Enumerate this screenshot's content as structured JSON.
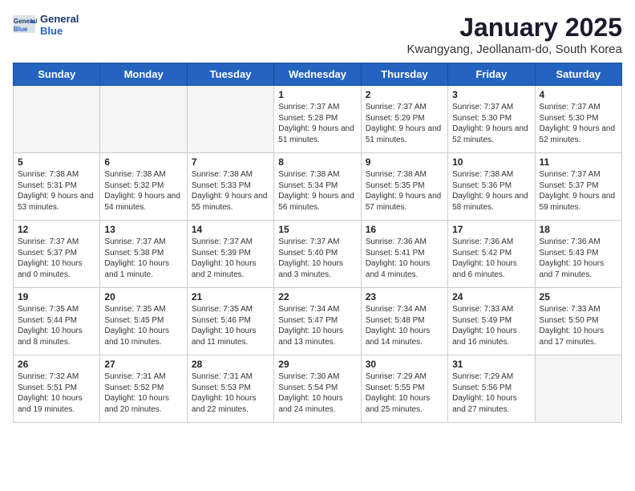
{
  "header": {
    "logo_line1": "General",
    "logo_line2": "Blue",
    "title": "January 2025",
    "subtitle": "Kwangyang, Jeollanam-do, South Korea"
  },
  "days_of_week": [
    "Sunday",
    "Monday",
    "Tuesday",
    "Wednesday",
    "Thursday",
    "Friday",
    "Saturday"
  ],
  "weeks": [
    [
      {
        "day": "",
        "text": ""
      },
      {
        "day": "",
        "text": ""
      },
      {
        "day": "",
        "text": ""
      },
      {
        "day": "1",
        "text": "Sunrise: 7:37 AM\nSunset: 5:28 PM\nDaylight: 9 hours and 51 minutes."
      },
      {
        "day": "2",
        "text": "Sunrise: 7:37 AM\nSunset: 5:29 PM\nDaylight: 9 hours and 51 minutes."
      },
      {
        "day": "3",
        "text": "Sunrise: 7:37 AM\nSunset: 5:30 PM\nDaylight: 9 hours and 52 minutes."
      },
      {
        "day": "4",
        "text": "Sunrise: 7:37 AM\nSunset: 5:30 PM\nDaylight: 9 hours and 52 minutes."
      }
    ],
    [
      {
        "day": "5",
        "text": "Sunrise: 7:38 AM\nSunset: 5:31 PM\nDaylight: 9 hours and 53 minutes."
      },
      {
        "day": "6",
        "text": "Sunrise: 7:38 AM\nSunset: 5:32 PM\nDaylight: 9 hours and 54 minutes."
      },
      {
        "day": "7",
        "text": "Sunrise: 7:38 AM\nSunset: 5:33 PM\nDaylight: 9 hours and 55 minutes."
      },
      {
        "day": "8",
        "text": "Sunrise: 7:38 AM\nSunset: 5:34 PM\nDaylight: 9 hours and 56 minutes."
      },
      {
        "day": "9",
        "text": "Sunrise: 7:38 AM\nSunset: 5:35 PM\nDaylight: 9 hours and 57 minutes."
      },
      {
        "day": "10",
        "text": "Sunrise: 7:38 AM\nSunset: 5:36 PM\nDaylight: 9 hours and 58 minutes."
      },
      {
        "day": "11",
        "text": "Sunrise: 7:37 AM\nSunset: 5:37 PM\nDaylight: 9 hours and 59 minutes."
      }
    ],
    [
      {
        "day": "12",
        "text": "Sunrise: 7:37 AM\nSunset: 5:37 PM\nDaylight: 10 hours and 0 minutes."
      },
      {
        "day": "13",
        "text": "Sunrise: 7:37 AM\nSunset: 5:38 PM\nDaylight: 10 hours and 1 minute."
      },
      {
        "day": "14",
        "text": "Sunrise: 7:37 AM\nSunset: 5:39 PM\nDaylight: 10 hours and 2 minutes."
      },
      {
        "day": "15",
        "text": "Sunrise: 7:37 AM\nSunset: 5:40 PM\nDaylight: 10 hours and 3 minutes."
      },
      {
        "day": "16",
        "text": "Sunrise: 7:36 AM\nSunset: 5:41 PM\nDaylight: 10 hours and 4 minutes."
      },
      {
        "day": "17",
        "text": "Sunrise: 7:36 AM\nSunset: 5:42 PM\nDaylight: 10 hours and 6 minutes."
      },
      {
        "day": "18",
        "text": "Sunrise: 7:36 AM\nSunset: 5:43 PM\nDaylight: 10 hours and 7 minutes."
      }
    ],
    [
      {
        "day": "19",
        "text": "Sunrise: 7:35 AM\nSunset: 5:44 PM\nDaylight: 10 hours and 8 minutes."
      },
      {
        "day": "20",
        "text": "Sunrise: 7:35 AM\nSunset: 5:45 PM\nDaylight: 10 hours and 10 minutes."
      },
      {
        "day": "21",
        "text": "Sunrise: 7:35 AM\nSunset: 5:46 PM\nDaylight: 10 hours and 11 minutes."
      },
      {
        "day": "22",
        "text": "Sunrise: 7:34 AM\nSunset: 5:47 PM\nDaylight: 10 hours and 13 minutes."
      },
      {
        "day": "23",
        "text": "Sunrise: 7:34 AM\nSunset: 5:48 PM\nDaylight: 10 hours and 14 minutes."
      },
      {
        "day": "24",
        "text": "Sunrise: 7:33 AM\nSunset: 5:49 PM\nDaylight: 10 hours and 16 minutes."
      },
      {
        "day": "25",
        "text": "Sunrise: 7:33 AM\nSunset: 5:50 PM\nDaylight: 10 hours and 17 minutes."
      }
    ],
    [
      {
        "day": "26",
        "text": "Sunrise: 7:32 AM\nSunset: 5:51 PM\nDaylight: 10 hours and 19 minutes."
      },
      {
        "day": "27",
        "text": "Sunrise: 7:31 AM\nSunset: 5:52 PM\nDaylight: 10 hours and 20 minutes."
      },
      {
        "day": "28",
        "text": "Sunrise: 7:31 AM\nSunset: 5:53 PM\nDaylight: 10 hours and 22 minutes."
      },
      {
        "day": "29",
        "text": "Sunrise: 7:30 AM\nSunset: 5:54 PM\nDaylight: 10 hours and 24 minutes."
      },
      {
        "day": "30",
        "text": "Sunrise: 7:29 AM\nSunset: 5:55 PM\nDaylight: 10 hours and 25 minutes."
      },
      {
        "day": "31",
        "text": "Sunrise: 7:29 AM\nSunset: 5:56 PM\nDaylight: 10 hours and 27 minutes."
      },
      {
        "day": "",
        "text": ""
      }
    ]
  ]
}
